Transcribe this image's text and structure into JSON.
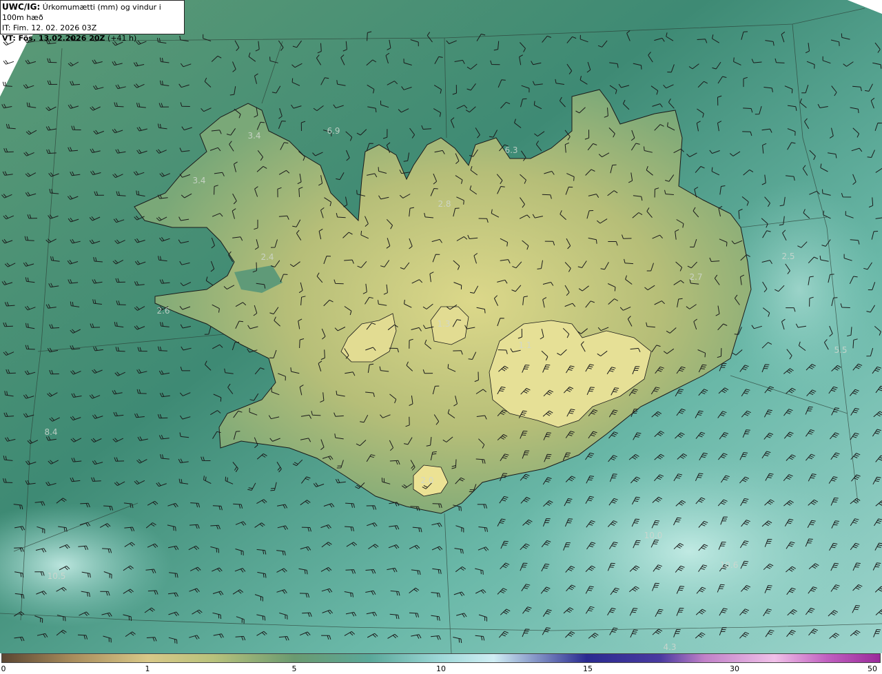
{
  "header": {
    "model": "UWC/IG:",
    "title": "Úrkomumætti (mm) og vindur i 100m hæð",
    "it_label": "IT: Fim. 12. 02. 2026 03Z",
    "vt_bold": "VT: Fös. 13.02.2026 20Z",
    "vt_suffix": " (+41 h)"
  },
  "colorbar": {
    "ticks": [
      "0",
      "1",
      "5",
      "10",
      "15",
      "30",
      "50"
    ],
    "colors": [
      "#5b4632",
      "#d8c888",
      "#6a9a70",
      "#9ed8d8",
      "#2a2a90",
      "#c080c8",
      "#9a2a9a"
    ]
  },
  "map_values": [
    "3.4",
    "6.9",
    "6.3",
    "3.4",
    "2.8",
    "2.4",
    "2.5",
    "2.7",
    "2.6",
    "1.3",
    "1.1",
    "5.5",
    "8.4",
    "2.0",
    "10.5",
    "10.0",
    "10.6",
    "4.3"
  ]
}
